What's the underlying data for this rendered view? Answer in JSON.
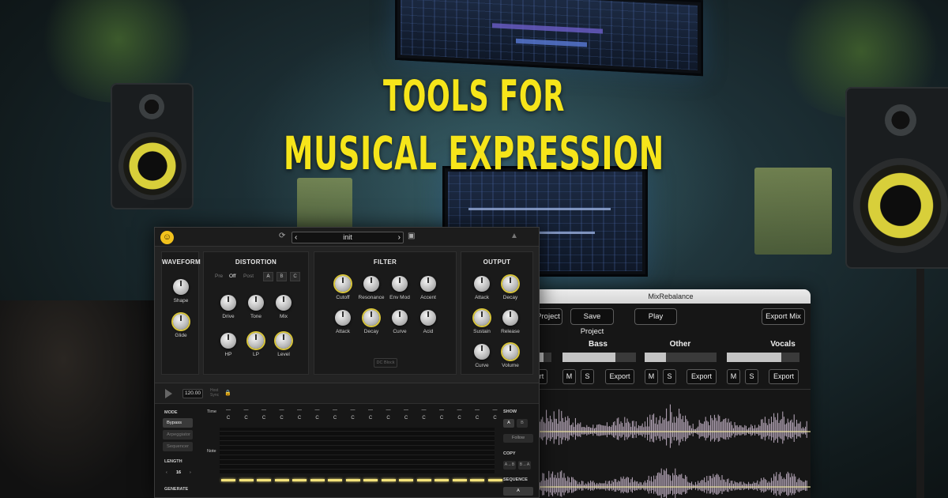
{
  "headline": {
    "line1": "TOOLS FOR",
    "line2": "MUSICAL EXPRESSION"
  },
  "colors": {
    "headline": "#f6e51a",
    "knob_accent": "#d8c53a",
    "gate": "#f3e27a",
    "waveform": "#d9c7dc"
  },
  "mix_window": {
    "title": "MixRebalance",
    "toolbar": {
      "load_project": "d Project",
      "save_project": "Save Project",
      "play": "Play",
      "export_mix": "Export Mix"
    },
    "stems": [
      {
        "name": "",
        "level": 0.6,
        "export": "port"
      },
      {
        "name": "Bass",
        "level": 0.72,
        "export": "Export"
      },
      {
        "name": "Other",
        "level": 0.3,
        "export": "Export"
      },
      {
        "name": "Vocals",
        "level": 0.75,
        "export": "Export"
      }
    ],
    "mute_label": "M",
    "solo_label": "S"
  },
  "synth": {
    "logo_icon": "smiley-icon",
    "preset": "init",
    "waveform": {
      "title": "WAVEFORM",
      "knobs": [
        "Shape",
        "Glide"
      ]
    },
    "distortion": {
      "title": "DISTORTION",
      "modes": [
        "Pre",
        "Off",
        "Post"
      ],
      "selected_mode": "Off",
      "variants": [
        "A",
        "B",
        "C"
      ],
      "knobs": [
        "Drive",
        "Tone",
        "Mix",
        "HP",
        "LP",
        "Level"
      ]
    },
    "filter": {
      "title": "FILTER",
      "knobs": [
        "Cutoff",
        "Resonance",
        "Env Mod",
        "Accent",
        "Attack",
        "Decay",
        "Curve",
        "Acid"
      ],
      "dc_block": "DC Block"
    },
    "output": {
      "title": "OUTPUT",
      "knobs": [
        "Attack",
        "Decay",
        "Sustain",
        "Release",
        "Curve",
        "Volume"
      ]
    },
    "sequencer": {
      "bpm": "120.00",
      "lock_label_1": "Host",
      "lock_label_2": "Sync",
      "mode_label": "MODE",
      "modes": [
        "Bypass",
        "Arpeggiator",
        "Sequencer"
      ],
      "selected_mode": "Bypass",
      "length_label": "LENGTH",
      "length_value": "16",
      "generate_label": "GENERATE",
      "time_label": "Time",
      "note_label": "Note",
      "steps": [
        "C",
        "C",
        "C",
        "C",
        "C",
        "C",
        "C",
        "C",
        "C",
        "C",
        "C",
        "C",
        "C",
        "C",
        "C",
        "C"
      ],
      "show_label": "SHOW",
      "show_a": "A",
      "show_b": "B",
      "follow": "Follow",
      "copy_label": "COPY",
      "copy_ab": "A→B",
      "copy_ba": "B→A",
      "sequence_label": "SEQUENCE",
      "sequence_value": "A"
    }
  }
}
